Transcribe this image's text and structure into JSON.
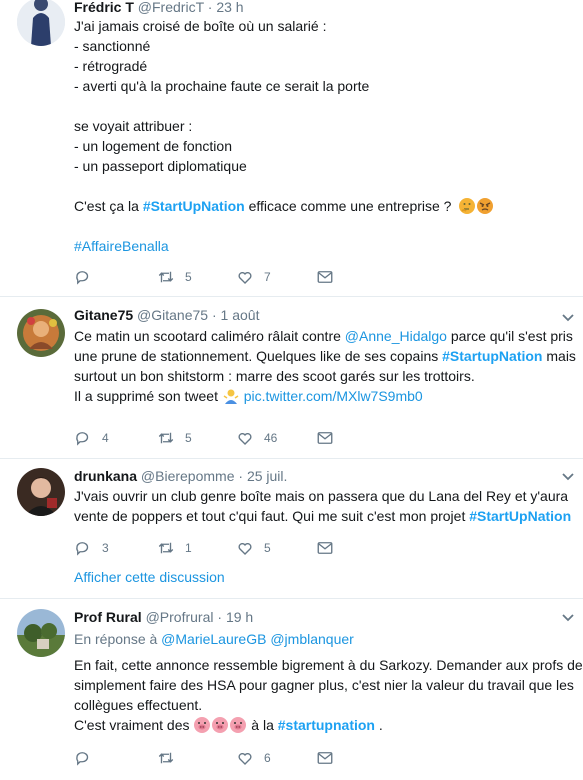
{
  "tweets": [
    {
      "name": "Frédric T",
      "handle": "@FredricT",
      "sep": "·",
      "time": "23 h",
      "lines": [
        "J'ai jamais croisé de boîte où un salarié :",
        "- sanctionné",
        "- rétrogradé",
        "- averti qu'à la prochaine faute ce serait la porte",
        "",
        "se voyait attribuer :",
        "- un logement de fonction",
        "- un passeport diplomatique",
        "",
        ""
      ],
      "line9_pre": "C'est ça la ",
      "line9_tag": "#StartUpNation",
      "line9_post": " efficace comme une entreprise ?",
      "hashtag_line": "#AffaireBenalla",
      "reply_count": "",
      "retweet_count": "5",
      "like_count": "7"
    },
    {
      "name": "Gitane75",
      "handle": "@Gitane75",
      "sep": "·",
      "time": "1 août",
      "l1_pre": "Ce matin un scootard caliméro râlait contre ",
      "l1_mention": "@Anne_Hidalgo",
      "l1_post": " parce qu'il s'est pris",
      "l2_pre": "une prune de stationnement. Quelques like de ses copains ",
      "l2_tag": "#StartupNation",
      "l2_post": " mais",
      "l3": "surtout un bon shitstorm : marre des scoot garés sur les trottoirs.",
      "l4_pre": "Il a supprimé son tweet ",
      "l4_link": "pic.twitter.com/MXlw7S9mb0",
      "reply_count": "4",
      "retweet_count": "5",
      "like_count": "46"
    },
    {
      "name": "drunkana",
      "handle": "@Bierepomme",
      "sep": "·",
      "time": "25 juil.",
      "l1": "J'vais ouvrir un club genre boîte mais on passera que du Lana del Rey et y'aura",
      "l2_pre": "vente de poppers et tout c'qui faut. Qui me suit c'est mon projet ",
      "l2_tag": "#StartUpNation",
      "reply_count": "3",
      "retweet_count": "1",
      "like_count": "5",
      "show_thread": "Afficher cette discussion"
    },
    {
      "name": "Prof Rural",
      "handle": "@Profrural",
      "sep": "·",
      "time": "19 h",
      "reply_prefix": "En réponse à ",
      "reply_mention1": "@MarieLaureGB",
      "reply_mention2": "@jmblanquer",
      "l1": "En fait, cette annonce ressemble bigrement à du Sarkozy. Demander aux profs de",
      "l2": "simplement faire des HSA pour gagner plus, c'est nier la valeur du travail que les",
      "l3": "collègues effectuent.",
      "l4_pre": "C'est vraiment des ",
      "l4_mid": " à la ",
      "l4_tag": "#startupnation",
      "l4_post": " .",
      "reply_count": "",
      "retweet_count": "",
      "like_count": "6"
    }
  ],
  "colors": {
    "accent": "#1da1f2",
    "muted": "#657786",
    "border": "#e6ecf0"
  }
}
